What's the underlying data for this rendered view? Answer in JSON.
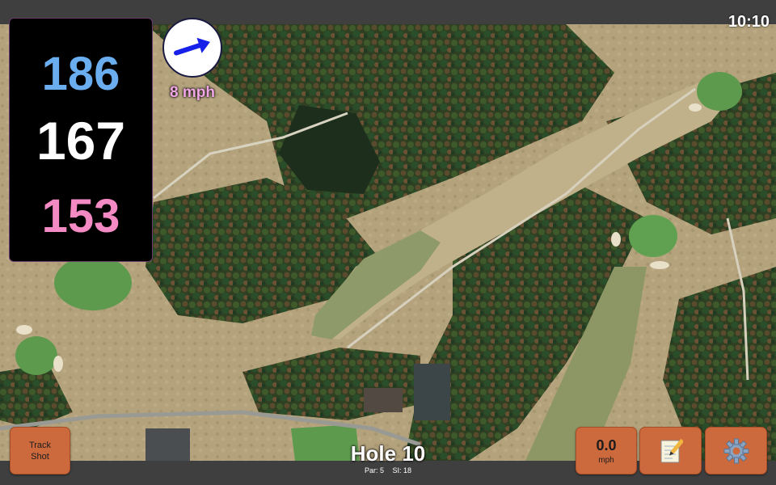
{
  "status_bar": {
    "time": "10:10"
  },
  "distances": {
    "back": "186",
    "center": "167",
    "front": "153"
  },
  "wind": {
    "speed": "8 mph",
    "icon": "wind-arrow-icon",
    "direction": "east-northeast"
  },
  "buttons": {
    "track_shot_line1": "Track",
    "track_shot_line2": "Shot",
    "speed_value": "0.0",
    "speed_unit": "mph",
    "notes_icon": "notepad-icon",
    "settings_icon": "gear-icon"
  },
  "hole": {
    "title": "Hole 10",
    "par": "Par: 5",
    "stroke_index": "SI: 18"
  },
  "colors": {
    "back_distance": "#6aaef0",
    "center_distance": "#ffffff",
    "front_distance": "#f48ac4",
    "wind_text": "#f1a7e6",
    "button": "#cc6a3d",
    "bar": "#3f3f3f"
  }
}
